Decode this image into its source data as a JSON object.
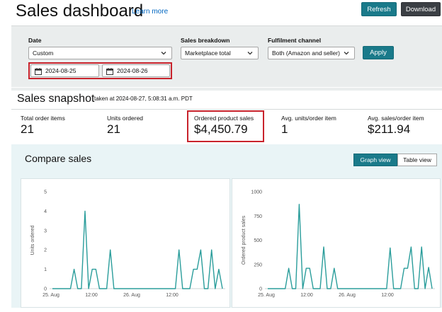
{
  "header": {
    "title": "Sales dashboard",
    "learn_more": "Learn more",
    "refresh_label": "Refresh",
    "download_label": "Download"
  },
  "filters": {
    "date_label": "Date",
    "date_value": "Custom",
    "date_start": "2024-08-25",
    "date_end": "2024-08-26",
    "breakdown_label": "Sales breakdown",
    "breakdown_value": "Marketplace total",
    "channel_label": "Fulfilment channel",
    "channel_value": "Both (Amazon and seller)",
    "apply_label": "Apply"
  },
  "snapshot": {
    "title": "Sales snapshot",
    "taken": "taken at 2024-08-27, 5:08:31 a.m. PDT",
    "metrics": [
      {
        "label": "Total order items",
        "value": "21"
      },
      {
        "label": "Units ordered",
        "value": "21"
      },
      {
        "label": "Ordered product sales",
        "value": "$4,450.79"
      },
      {
        "label": "Avg. units/order item",
        "value": "1"
      },
      {
        "label": "Avg. sales/order item",
        "value": "$211.94"
      }
    ]
  },
  "compare": {
    "title": "Compare sales",
    "graph_view_label": "Graph view",
    "table_view_label": "Table view"
  },
  "colors": {
    "accent": "#1a7a8a",
    "line": "#2a9d9b",
    "highlight": "#c8232c"
  },
  "chart_data": [
    {
      "type": "line",
      "title": "",
      "xlabel": "",
      "ylabel": "Units ordered",
      "ylim": [
        0,
        5
      ],
      "yticks": [
        "0",
        "1",
        "2",
        "3",
        "4",
        "5"
      ],
      "xticks": [
        "25. Aug",
        "12:00",
        "26. Aug",
        "12:00"
      ],
      "x": [
        0,
        1,
        2,
        3,
        4,
        5,
        6,
        7,
        8,
        9,
        10,
        11,
        12,
        13,
        14,
        15,
        16,
        17,
        18,
        19,
        20,
        21,
        22,
        23,
        24,
        25,
        26,
        27,
        28,
        29,
        30,
        31,
        32,
        33,
        34,
        35,
        36,
        37,
        38,
        39,
        40,
        41,
        42,
        43,
        44,
        45,
        46,
        47
      ],
      "series": [
        {
          "values": [
            0,
            0,
            0,
            0,
            0,
            0,
            1,
            0,
            0,
            4,
            0,
            1,
            1,
            0,
            0,
            0,
            2,
            0,
            0,
            0,
            0,
            0,
            0,
            0,
            0,
            0,
            0,
            0,
            0,
            0,
            0,
            0,
            0,
            0,
            0,
            2,
            0,
            0,
            0,
            1,
            1,
            2,
            0,
            0,
            2,
            0,
            1,
            0
          ]
        }
      ]
    },
    {
      "type": "line",
      "title": "",
      "xlabel": "",
      "ylabel": "Ordered product sales",
      "ylim": [
        0,
        1000
      ],
      "yticks": [
        "0",
        "250",
        "500",
        "750",
        "1000"
      ],
      "xticks": [
        "25. Aug",
        "12:00",
        "26. Aug",
        "12:00"
      ],
      "x": [
        0,
        1,
        2,
        3,
        4,
        5,
        6,
        7,
        8,
        9,
        10,
        11,
        12,
        13,
        14,
        15,
        16,
        17,
        18,
        19,
        20,
        21,
        22,
        23,
        24,
        25,
        26,
        27,
        28,
        29,
        30,
        31,
        32,
        33,
        34,
        35,
        36,
        37,
        38,
        39,
        40,
        41,
        42,
        43,
        44,
        45,
        46,
        47
      ],
      "series": [
        {
          "values": [
            0,
            0,
            0,
            0,
            0,
            0,
            210,
            0,
            0,
            870,
            0,
            210,
            210,
            0,
            0,
            0,
            430,
            0,
            0,
            210,
            0,
            0,
            0,
            0,
            0,
            0,
            0,
            0,
            0,
            0,
            0,
            0,
            0,
            0,
            0,
            420,
            0,
            0,
            0,
            210,
            210,
            430,
            0,
            0,
            430,
            0,
            220,
            0
          ]
        }
      ]
    }
  ]
}
